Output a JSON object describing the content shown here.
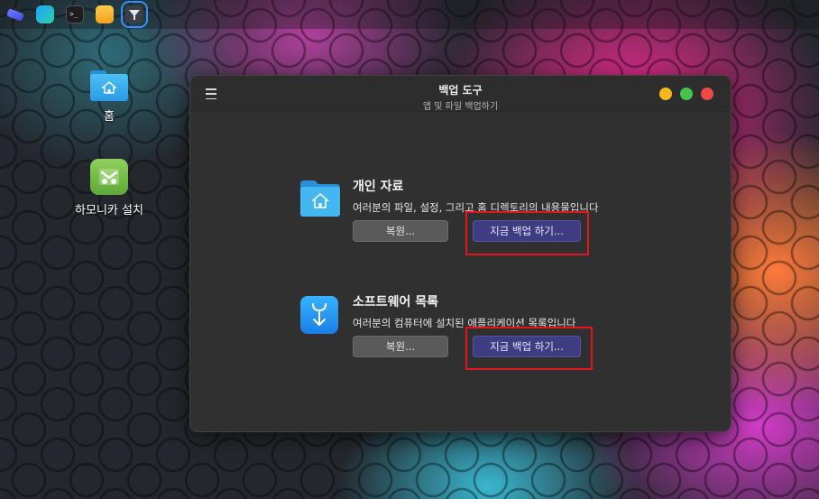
{
  "panel": {
    "apps": [
      {
        "name": "telescope-app-icon"
      },
      {
        "name": "app-store-icon"
      },
      {
        "name": "terminal-icon"
      },
      {
        "name": "files-icon"
      },
      {
        "name": "filter-app-icon"
      }
    ],
    "terminal_glyph": ">_"
  },
  "desktop": {
    "home_label": "홈",
    "install_label": "하모니카 설치"
  },
  "window": {
    "title": "백업 도구",
    "subtitle": "앱 및 파일 백업하기"
  },
  "sections": [
    {
      "title": "개인 자료",
      "desc": "여러분의 파일, 설정, 그리고 홈 디렉토리의 내용물입니다",
      "restore_label": "복원...",
      "backup_label": "지금 백업 하기..."
    },
    {
      "title": "소프트웨어 목록",
      "desc": "여러분의 컴퓨터에 설치된 애플리케이션 목록입니다",
      "restore_label": "복원...",
      "backup_label": "지금 백업 하기..."
    }
  ],
  "colors": {
    "accent": "#3e3d82",
    "highlight": "#e8141c",
    "close": "#ec4b43",
    "minimize": "#f6b61c",
    "maximize": "#43c44f"
  }
}
